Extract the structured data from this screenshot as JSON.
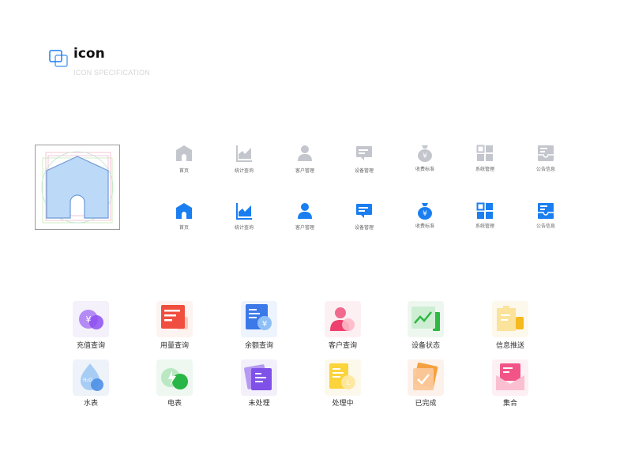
{
  "header": {
    "title": "icon",
    "subtitle": "ICON SPECIFICATION"
  },
  "colors": {
    "gray": "#c3c6cc",
    "blue": "#1a7ef0",
    "spec_fill": "#bcdaf8",
    "spec_stroke": "#6f9ad8"
  },
  "nav_icons": {
    "labels": [
      "首页",
      "统计查询",
      "客户管理",
      "设备管理",
      "收费标准",
      "系统管理",
      "公告信息"
    ],
    "yen": "¥"
  },
  "app_icons": {
    "row1": [
      "充值查询",
      "用量查询",
      "余额查询",
      "客户查询",
      "设备状态",
      "信息推送"
    ],
    "row2": [
      "水表",
      "电表",
      "未处理",
      "处理中",
      "已完成",
      "集合"
    ],
    "water_text": "H₂O",
    "yen": "¥",
    "l_text": "L"
  }
}
